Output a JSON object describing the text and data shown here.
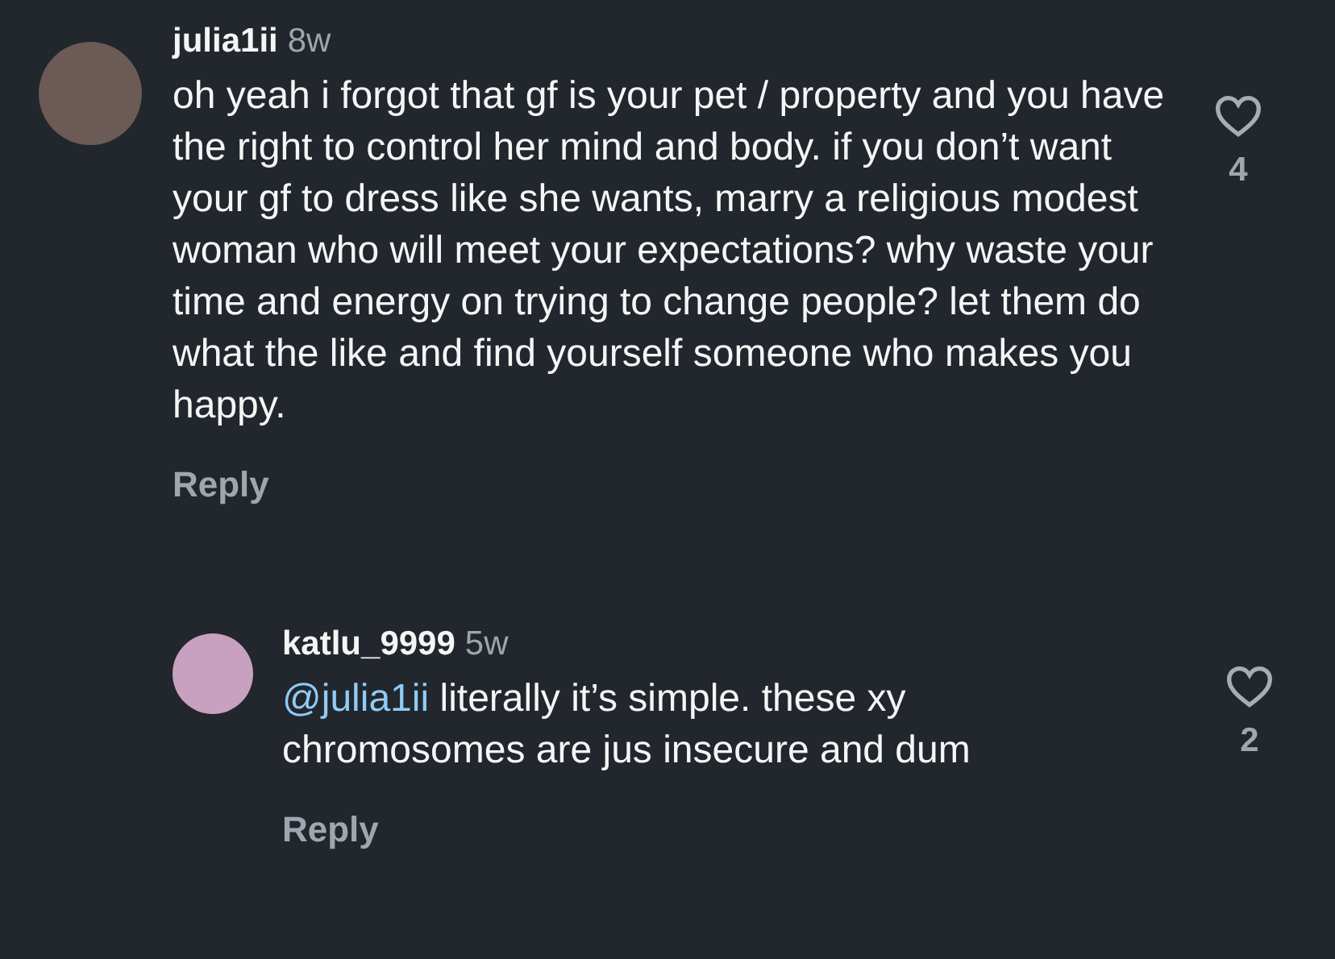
{
  "comments": [
    {
      "username": "julia1ii",
      "time": "8w",
      "text": "oh yeah i forgot that gf is your pet / property and you have the right to control her mind and body. if you don’t want your gf to dress like she wants, marry a religious modest woman who will meet your expectations? why waste your time and energy on trying to change people? let them do what the like and find yourself someone who makes you happy.",
      "reply_label": "Reply",
      "liked": false,
      "like_count": "4",
      "replies": [
        {
          "username": "katlu_9999",
          "time": "5w",
          "mention": "@julia1ii",
          "text": " literally it’s simple. these xy chromosomes are jus insecure and dum",
          "reply_label": "Reply",
          "liked": false,
          "like_count": "2"
        }
      ]
    }
  ]
}
